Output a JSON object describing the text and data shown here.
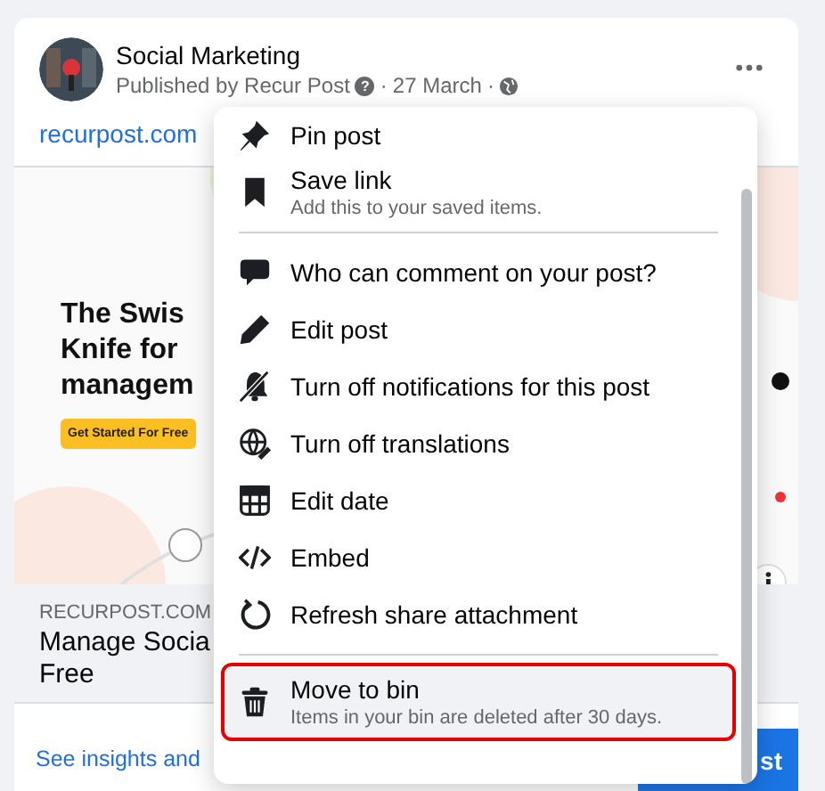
{
  "post": {
    "author": "Social Marketing",
    "published_by": "Published by Recur Post",
    "help_icon": "?",
    "separator": "·",
    "date": "27 March",
    "link": "recurpost.com",
    "image": {
      "headline": [
        "The Swis",
        "Knife for",
        "managem"
      ],
      "cta": "Get Started For Free"
    },
    "preview": {
      "domain": "RECURPOST.COM",
      "title": [
        "Manage Socia",
        "Free"
      ]
    },
    "insights_link": "See insights and",
    "boost_button": "st"
  },
  "menu": {
    "items": [
      {
        "kind": "pin",
        "label": "Pin post",
        "highlighted": false
      },
      {
        "kind": "bookmark",
        "label": "Save link",
        "description": "Add this to your saved items.",
        "highlighted": false
      },
      {
        "kind": "divider"
      },
      {
        "kind": "comment",
        "label": "Who can comment on your post?",
        "highlighted": false
      },
      {
        "kind": "pencil",
        "label": "Edit post",
        "highlighted": false
      },
      {
        "kind": "mute",
        "label": "Turn off notifications for this post",
        "highlighted": false
      },
      {
        "kind": "translate",
        "label": "Turn off translations",
        "highlighted": false
      },
      {
        "kind": "calendar",
        "label": "Edit date",
        "highlighted": false
      },
      {
        "kind": "code",
        "label": "Embed",
        "highlighted": false
      },
      {
        "kind": "refresh",
        "label": "Refresh share attachment",
        "highlighted": false
      },
      {
        "kind": "divider"
      },
      {
        "kind": "trash",
        "label": "Move to bin",
        "description": "Items in your bin are deleted after 30 days.",
        "highlighted": true
      }
    ]
  }
}
